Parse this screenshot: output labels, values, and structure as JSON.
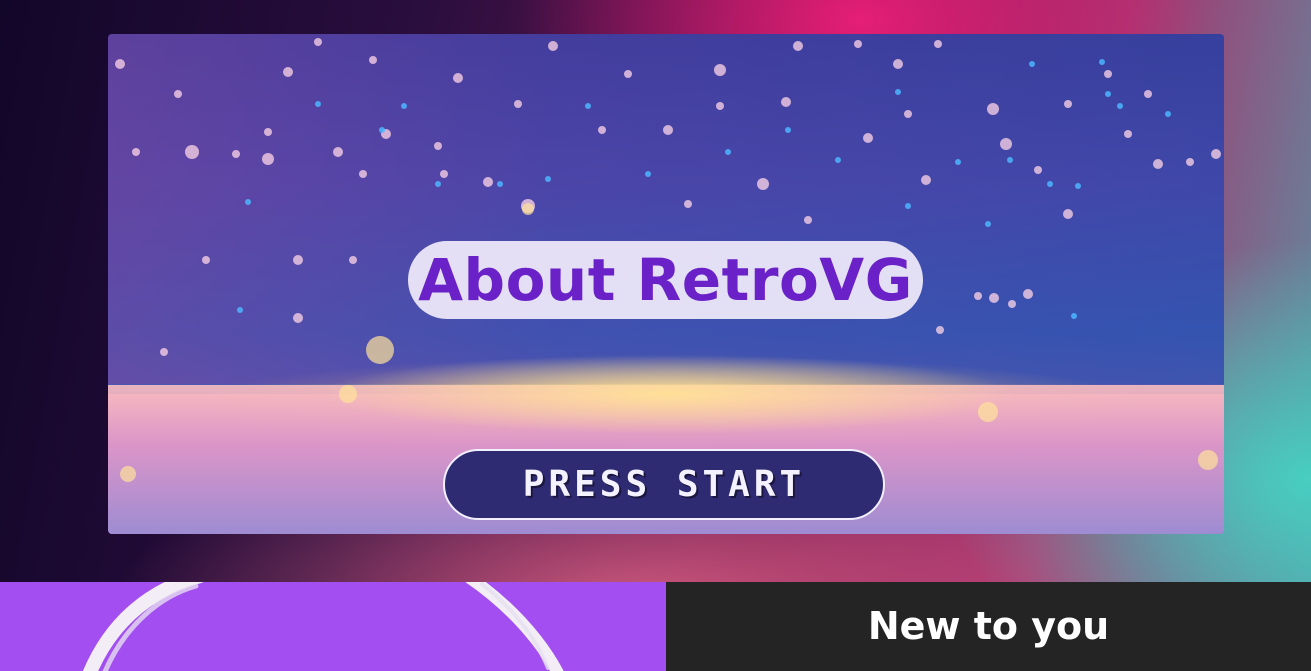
{
  "hero": {
    "title": "About RetroVG",
    "cta_label": "PRESS START"
  },
  "section": {
    "heading": "New to you"
  },
  "colors": {
    "title_purple": "#6a22c8",
    "button_navy": "#2f2b72",
    "panel_purple": "#a24ef0",
    "panel_dark": "#242424"
  },
  "icons": {
    "ring": "brush-circle-icon"
  }
}
